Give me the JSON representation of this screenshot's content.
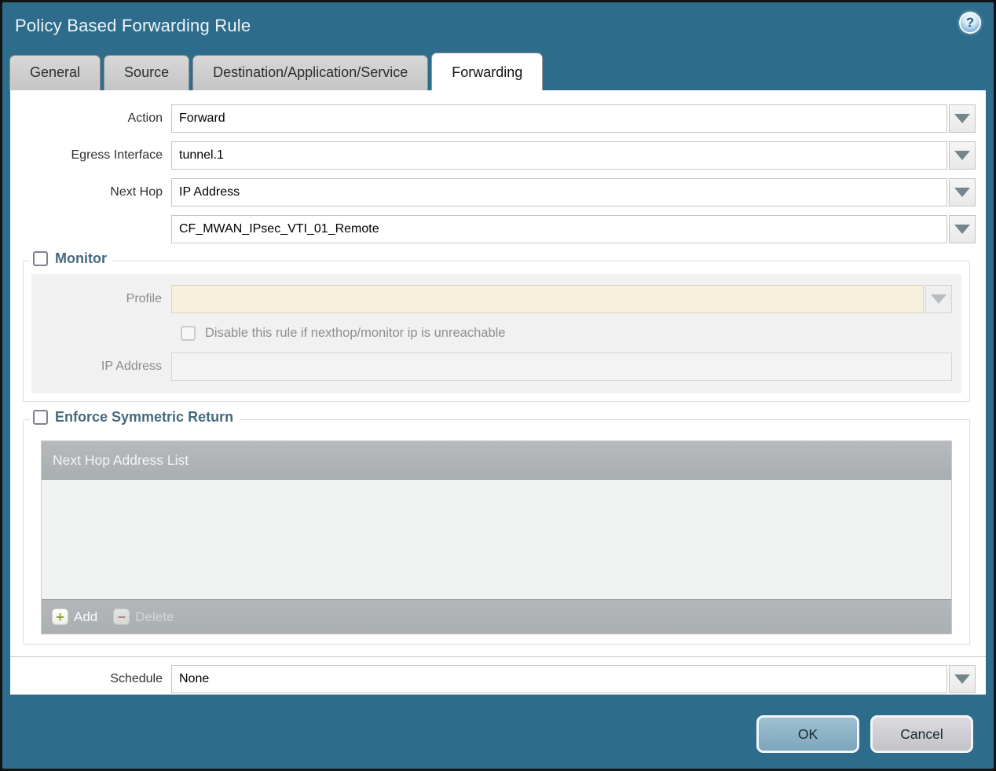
{
  "dialog": {
    "title": "Policy Based Forwarding Rule",
    "help_glyph": "?"
  },
  "tabs": [
    {
      "label": "General",
      "active": false
    },
    {
      "label": "Source",
      "active": false
    },
    {
      "label": "Destination/Application/Service",
      "active": false
    },
    {
      "label": "Forwarding",
      "active": true
    }
  ],
  "form": {
    "action": {
      "label": "Action",
      "value": "Forward"
    },
    "egress_interface": {
      "label": "Egress Interface",
      "value": "tunnel.1"
    },
    "next_hop": {
      "label": "Next Hop",
      "value": "IP Address"
    },
    "next_hop_address": {
      "value": "CF_MWAN_IPsec_VTI_01_Remote"
    },
    "schedule": {
      "label": "Schedule",
      "value": "None"
    }
  },
  "monitor": {
    "title": "Monitor",
    "checked": false,
    "profile": {
      "label": "Profile",
      "value": ""
    },
    "disable_rule_label": "Disable this rule if nexthop/monitor ip is unreachable",
    "disable_rule_checked": false,
    "ip_address": {
      "label": "IP Address",
      "value": ""
    }
  },
  "symmetric_return": {
    "title": "Enforce Symmetric Return",
    "checked": false,
    "table_header": "Next Hop Address List",
    "rows": [],
    "add_label": "Add",
    "add_icon": "+",
    "delete_label": "Delete",
    "delete_icon": "−"
  },
  "footer": {
    "ok_label": "OK",
    "cancel_label": "Cancel"
  },
  "colors": {
    "titlebar_teal": "#2e6c8c",
    "section_title_slate": "#44697d",
    "profile_field_cream": "#f6f0dc",
    "table_header_gray": "#aeb2b5",
    "ok_button_blue": "#8cb1c4",
    "cancel_button_gray": "#cdced2",
    "add_icon_green": "#93a43c",
    "delete_icon_red": "#ab7468"
  }
}
